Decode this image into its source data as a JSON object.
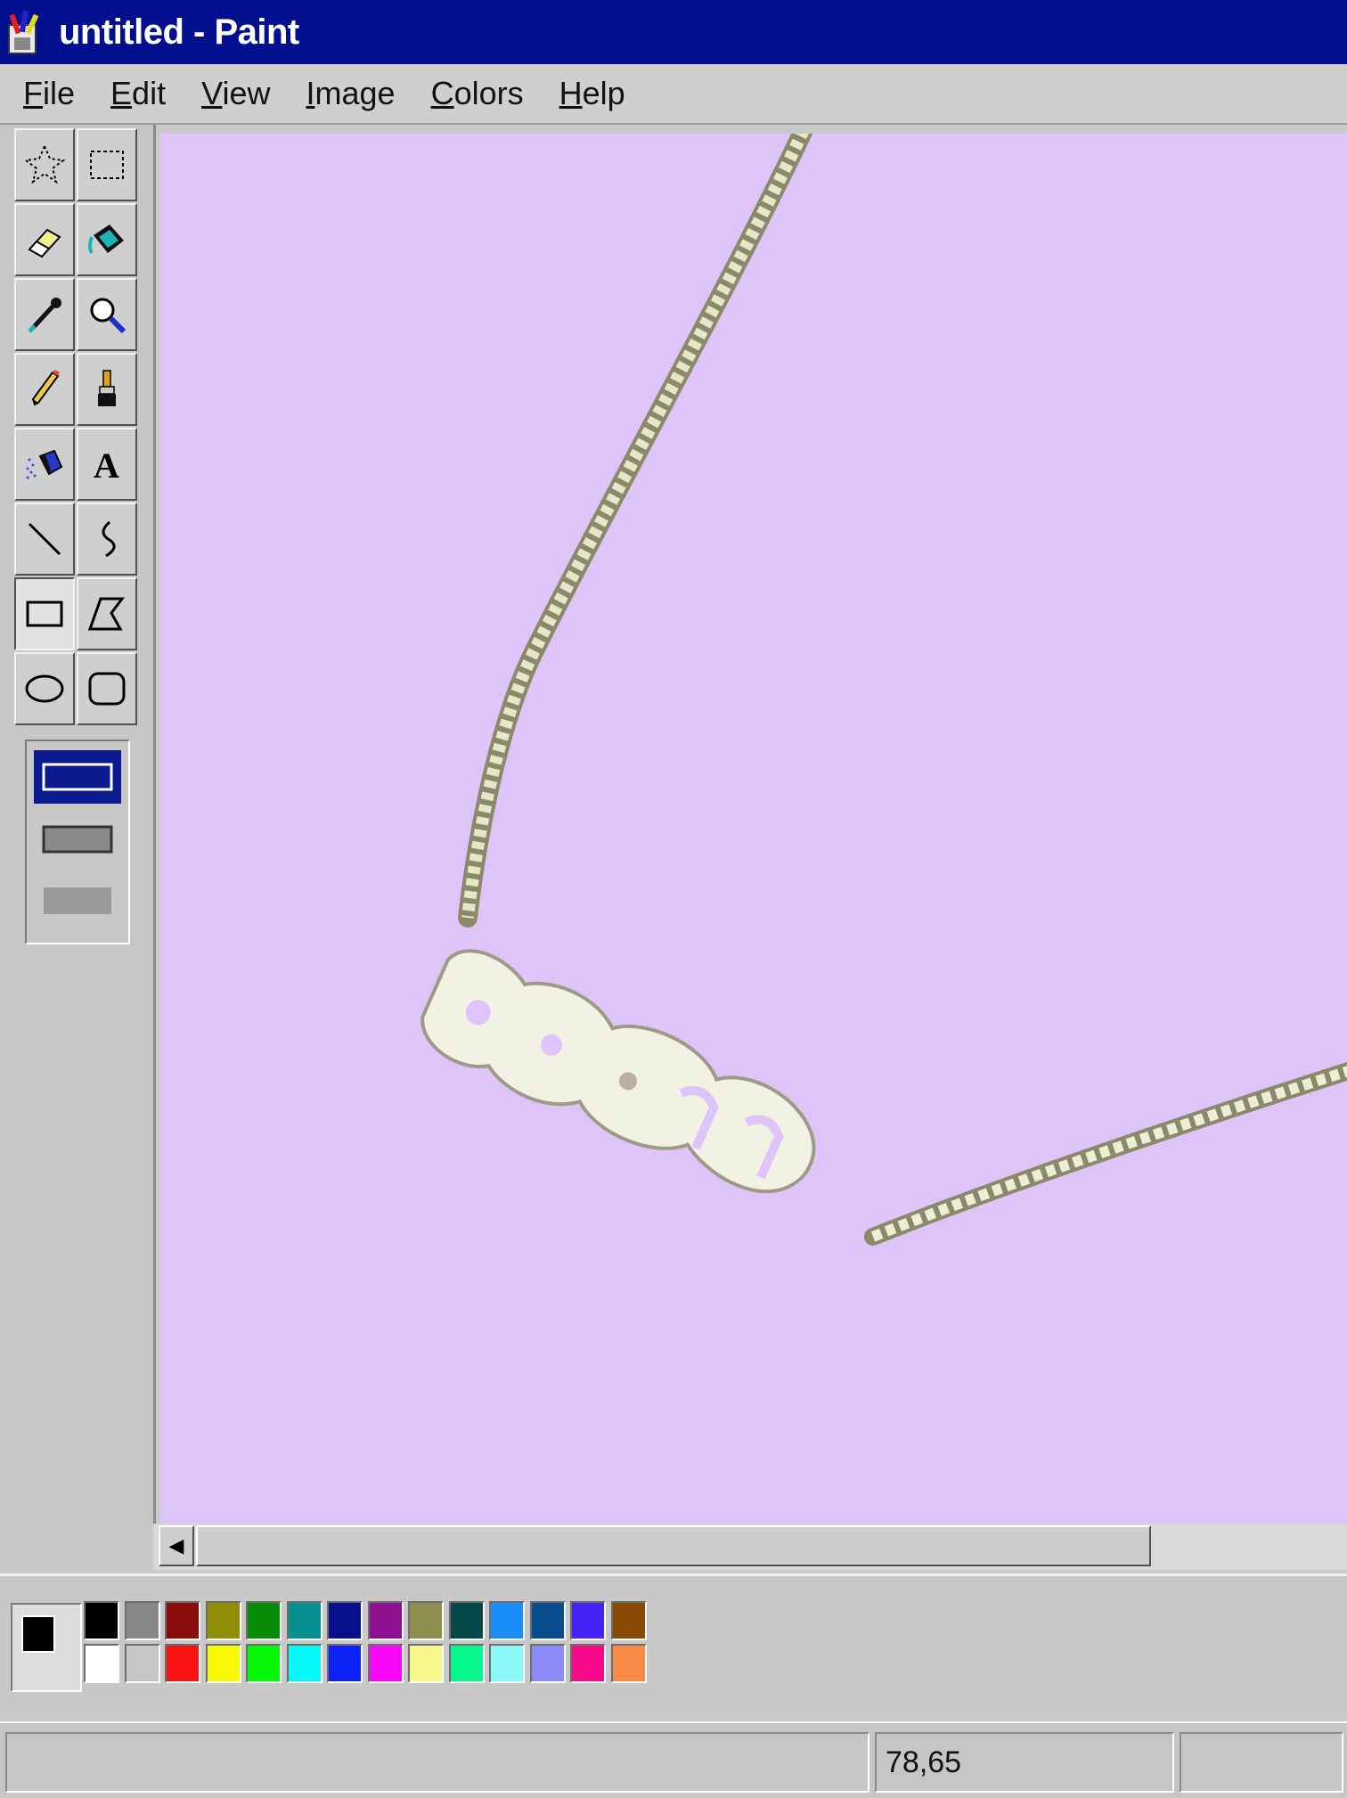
{
  "window": {
    "title": "untitled - Paint"
  },
  "menu": [
    {
      "label": "File",
      "key": "F",
      "rest": "ile"
    },
    {
      "label": "Edit",
      "key": "E",
      "rest": "dit"
    },
    {
      "label": "View",
      "key": "V",
      "rest": "iew"
    },
    {
      "label": "Image",
      "key": "I",
      "rest": "mage"
    },
    {
      "label": "Colors",
      "key": "C",
      "rest": "olors"
    },
    {
      "label": "Help",
      "key": "H",
      "rest": "elp"
    }
  ],
  "tools": [
    "free-form-select-icon",
    "rect-select-icon",
    "eraser-icon",
    "fill-icon",
    "pick-color-icon",
    "magnifier-icon",
    "pencil-icon",
    "brush-icon",
    "airbrush-icon",
    "text-icon",
    "line-icon",
    "curve-icon",
    "rectangle-icon",
    "polygon-icon",
    "ellipse-icon",
    "rounded-rectangle-icon"
  ],
  "selected_tool": "rectangle-icon",
  "canvas": {
    "background": "#dfc4fa",
    "image": "silver name necklace with chain"
  },
  "palette": {
    "foreground": "#000000",
    "background": "#ffffff",
    "top_row": [
      "#000000",
      "#888888",
      "#8b0a0a",
      "#8f8e06",
      "#078d06",
      "#079090",
      "#08108e",
      "#8e0f8f",
      "#8e8e4e",
      "#064848",
      "#1a8ef8",
      "#064c8e",
      "#4422f8",
      "#8a4a06"
    ],
    "bottom_row": [
      "#ffffff",
      "#c6c6c6",
      "#f81212",
      "#f8f806",
      "#06f806",
      "#06f8f8",
      "#0c22f8",
      "#f806f8",
      "#f8f88a",
      "#06f88a",
      "#8af8f8",
      "#8a8af8",
      "#f80a8a",
      "#f88a48"
    ]
  },
  "status": {
    "coords": "78,65"
  }
}
